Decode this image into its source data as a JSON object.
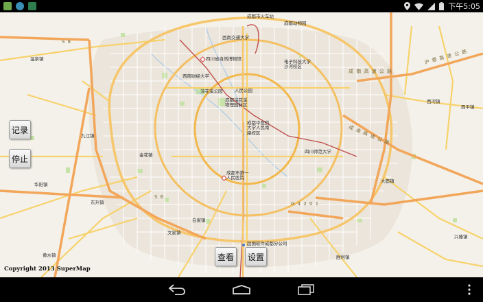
{
  "status_bar": {
    "time": "下午5:05",
    "icons": [
      "notification-app-icon",
      "notification-app-icon-2",
      "notification-app-icon-3",
      "location-icon",
      "wifi-icon",
      "signal-icon",
      "battery-icon"
    ]
  },
  "buttons": {
    "record": "记录",
    "stop": "停止",
    "view": "查看",
    "settings": "设置"
  },
  "copyright": "Copyright 2013 SuperMap",
  "map": {
    "roads": {
      "s8": "S 8",
      "s6": "S 6",
      "g4201": "G 4 2 0 1",
      "chengnan_expressway": "成 南 高 速 公 路",
      "chengyu_expressway": "成 渝 高 速 公 路",
      "huwu_expressway": "沪 蓉 高 速 公 路"
    },
    "places": {
      "zoo": "成都动物园",
      "unknown_top": "成都市火车站",
      "swjtu": "西南交通大学",
      "sichuan_museum": "四川省自然博物馆",
      "uestc": "电子科技大学\n沙河校区",
      "swufe": "西南财经大学",
      "people_park": "人民公园",
      "huanhuaxi": "浣花溪公园",
      "chengdu_botanical": "成都浣花溪\n物理园林区",
      "tcm_university": "成都中医药\n大学人民南\n路校区",
      "scu": "四川师范大学",
      "tianfu_square": "成都市第一\n人民医院",
      "ruantian": "超图软件成都分公司",
      "wenjiang": "温泉镇",
      "jiulong": "九江镇",
      "jinqiao": "金花镇",
      "huayuan": "华阳镇",
      "dongsheng": "东升镇",
      "baijia": "白家镇",
      "wenxing": "文星镇",
      "huangshui": "黄水镇",
      "xijiang": "西河镇",
      "xiping": "西平镇",
      "dayuan": "大面镇",
      "xingfu": "兴隆镇",
      "shengsheng": "胜利镇"
    }
  },
  "nav_icons": [
    "back-icon",
    "home-icon",
    "recent-apps-icon",
    "overflow-menu-icon"
  ]
}
